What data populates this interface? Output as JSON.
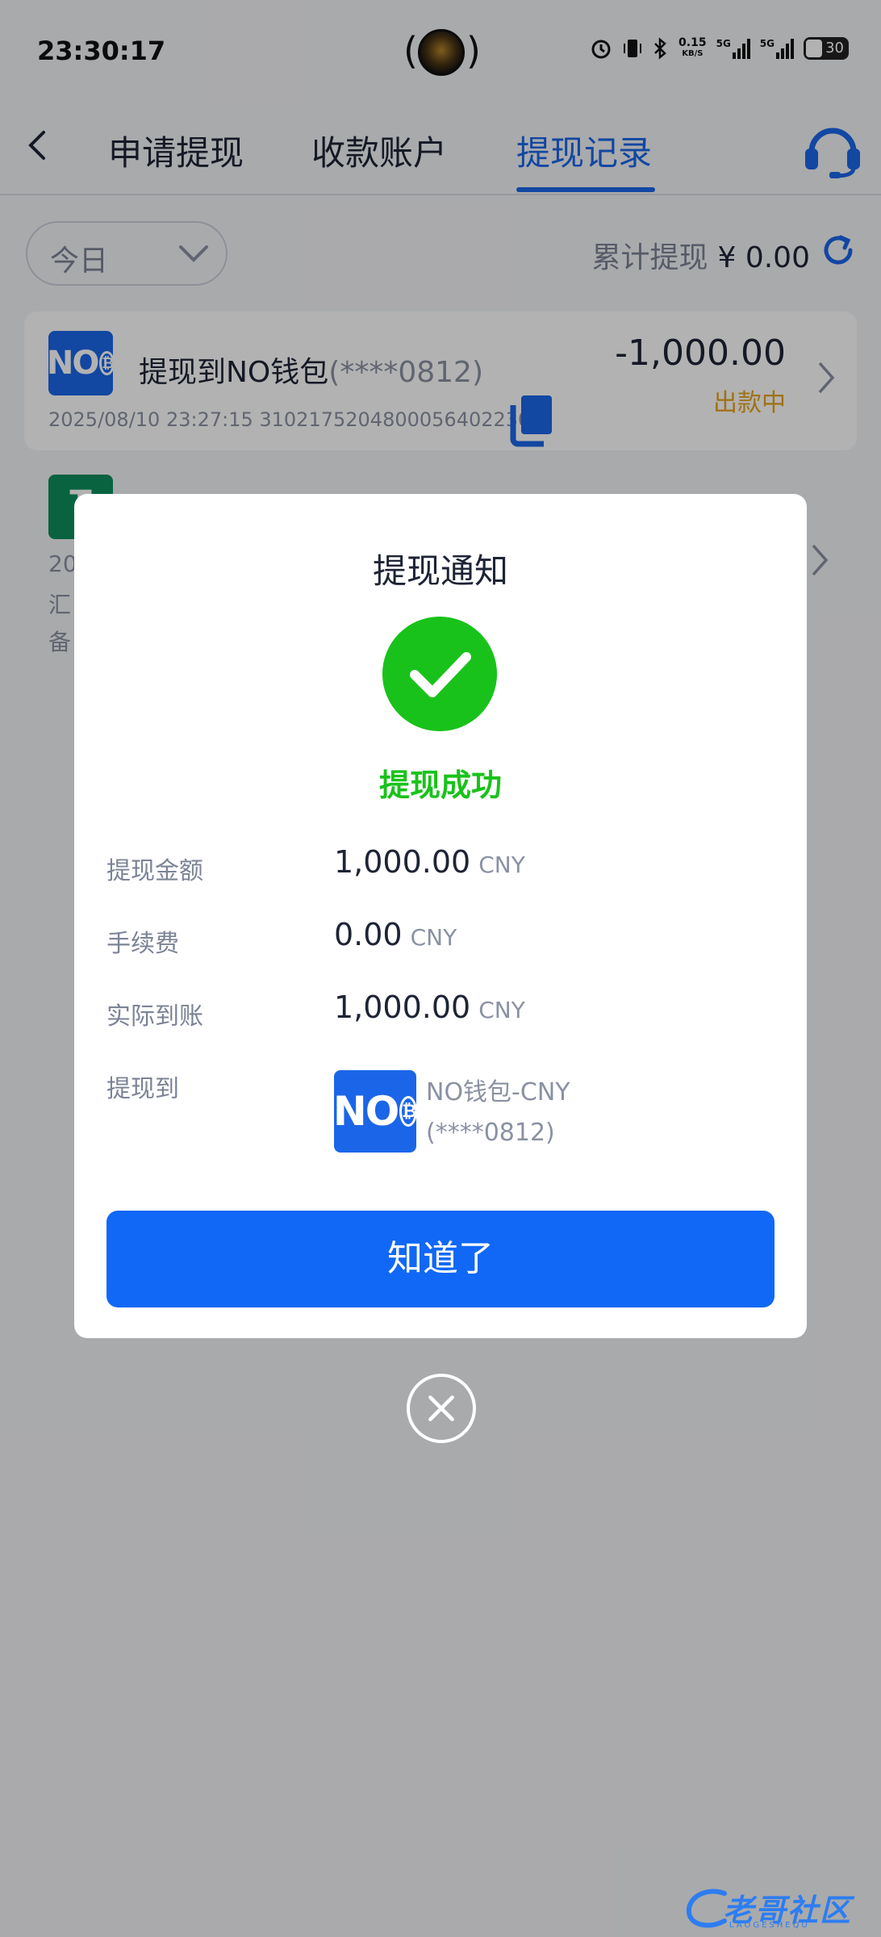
{
  "status_bar": {
    "time": "23:30:17",
    "net_speed": "0.15",
    "net_unit": "KB/S",
    "net1": "5G",
    "net2": "5G",
    "battery": "30"
  },
  "header": {
    "tabs": [
      {
        "label": "申请提现"
      },
      {
        "label": "收款账户"
      },
      {
        "label": "提现记录"
      }
    ],
    "active_tab": 2
  },
  "filter": {
    "selected": "今日",
    "total_label": "累计提现",
    "total_amount": "¥ 0.00"
  },
  "records": [
    {
      "title": "提现到NO钱包",
      "account_mask": "(****0812)",
      "amount": "-1,000.00",
      "status": "出款中",
      "meta": "2025/08/10 23:27:15 3102175204800056402230"
    }
  ],
  "record2_fragments": [
    "20",
    "汇",
    "备"
  ],
  "modal": {
    "title": "提现通知",
    "success_text": "提现成功",
    "rows": [
      {
        "label": "提现金额",
        "value": "1,000.00",
        "currency": "CNY"
      },
      {
        "label": "手续费",
        "value": "0.00",
        "currency": "CNY"
      },
      {
        "label": "实际到账",
        "value": "1,000.00",
        "currency": "CNY"
      }
    ],
    "destination_label": "提现到",
    "destination_name": "NO钱包-CNY",
    "destination_mask": "(****0812)",
    "confirm_label": "知道了"
  },
  "logo_text": "NO",
  "logo_coin": "₿",
  "record2_logo": "T",
  "watermark": {
    "text": "老哥社区",
    "sub": "LAOGESHEQU"
  },
  "colors": {
    "primary": "#1b66e8",
    "success": "#19c21b",
    "pending": "#e7a21a"
  }
}
